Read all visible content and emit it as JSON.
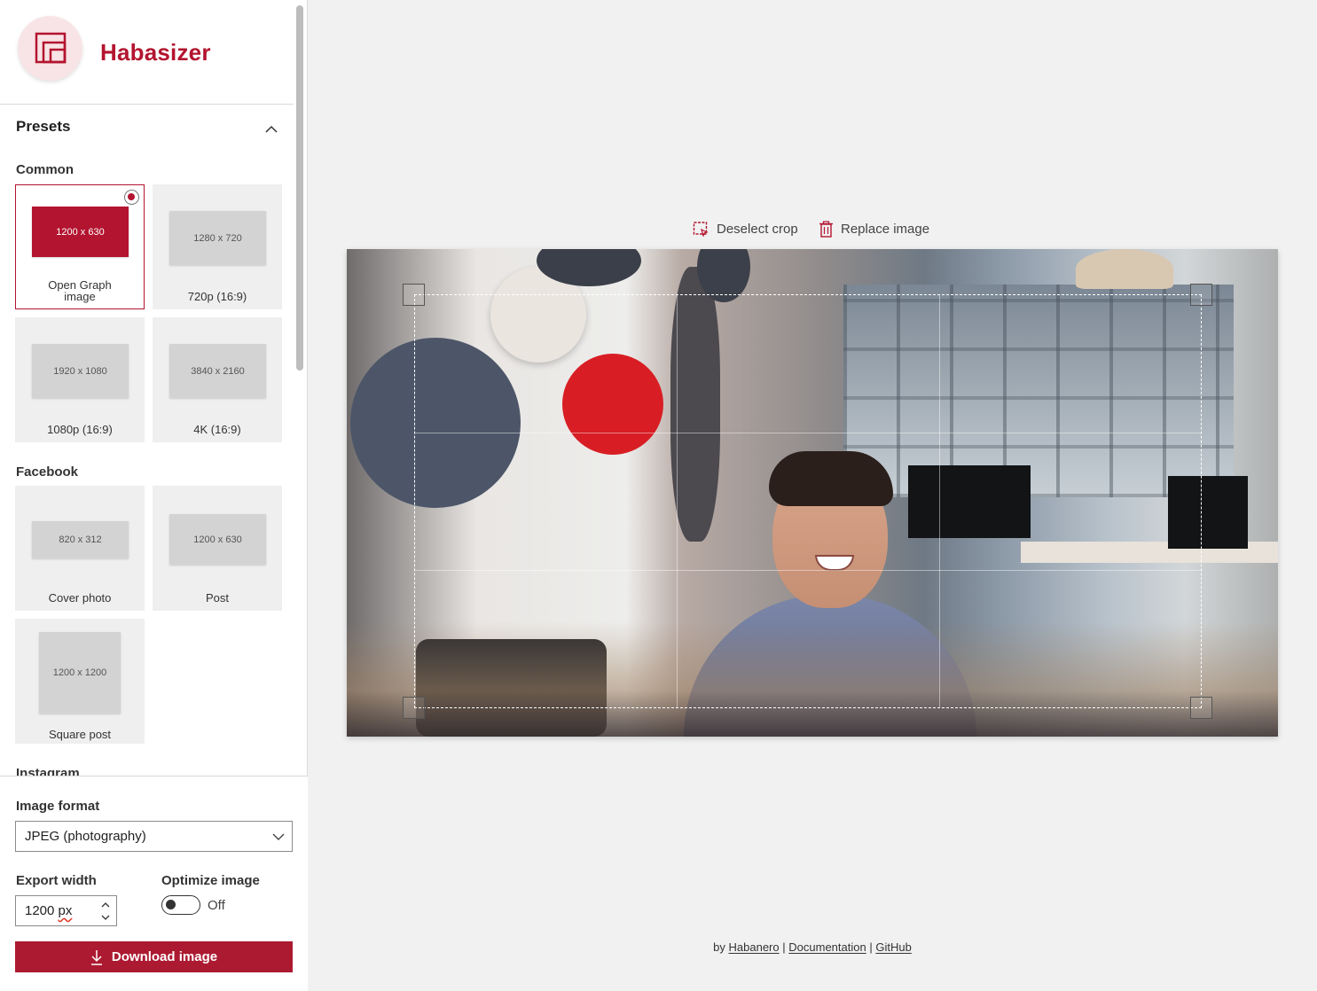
{
  "app": {
    "name": "Habasizer"
  },
  "presets": {
    "title": "Presets",
    "groups": [
      {
        "label": "Common",
        "tiles": [
          {
            "size": "1200 x 630",
            "label": "Open Graph image",
            "selected": true
          },
          {
            "size": "1280 x 720",
            "label": "720p (16:9)"
          },
          {
            "size": "1920 x 1080",
            "label": "1080p (16:9)"
          },
          {
            "size": "3840 x 2160",
            "label": "4K (16:9)"
          }
        ]
      },
      {
        "label": "Facebook",
        "tiles": [
          {
            "size": "820 x 312",
            "label": "Cover photo"
          },
          {
            "size": "1200 x 630",
            "label": "Post"
          },
          {
            "size": "1200 x 1200",
            "label": "Square post"
          }
        ]
      },
      {
        "label": "Instagram",
        "tiles": []
      }
    ]
  },
  "controls": {
    "format_label": "Image format",
    "format_value": "JPEG (photography)",
    "width_label": "Export width",
    "width_value": "1200",
    "width_unit": "px",
    "optimize_label": "Optimize image",
    "optimize_state": "Off",
    "download_label": "Download image"
  },
  "toolbar": {
    "deselect_label": "Deselect crop",
    "replace_label": "Replace image"
  },
  "footer": {
    "prefix": "by",
    "habanero": "Habanero",
    "sep1": "|",
    "documentation": "Documentation",
    "sep2": "|",
    "github": "GitHub"
  },
  "colors": {
    "accent": "#b3142f",
    "button": "#ac1a31"
  },
  "icons": [
    "app-logo-icon",
    "chevron-up-icon",
    "chevron-down-icon",
    "deselect-crop-icon",
    "trash-icon",
    "download-icon"
  ]
}
